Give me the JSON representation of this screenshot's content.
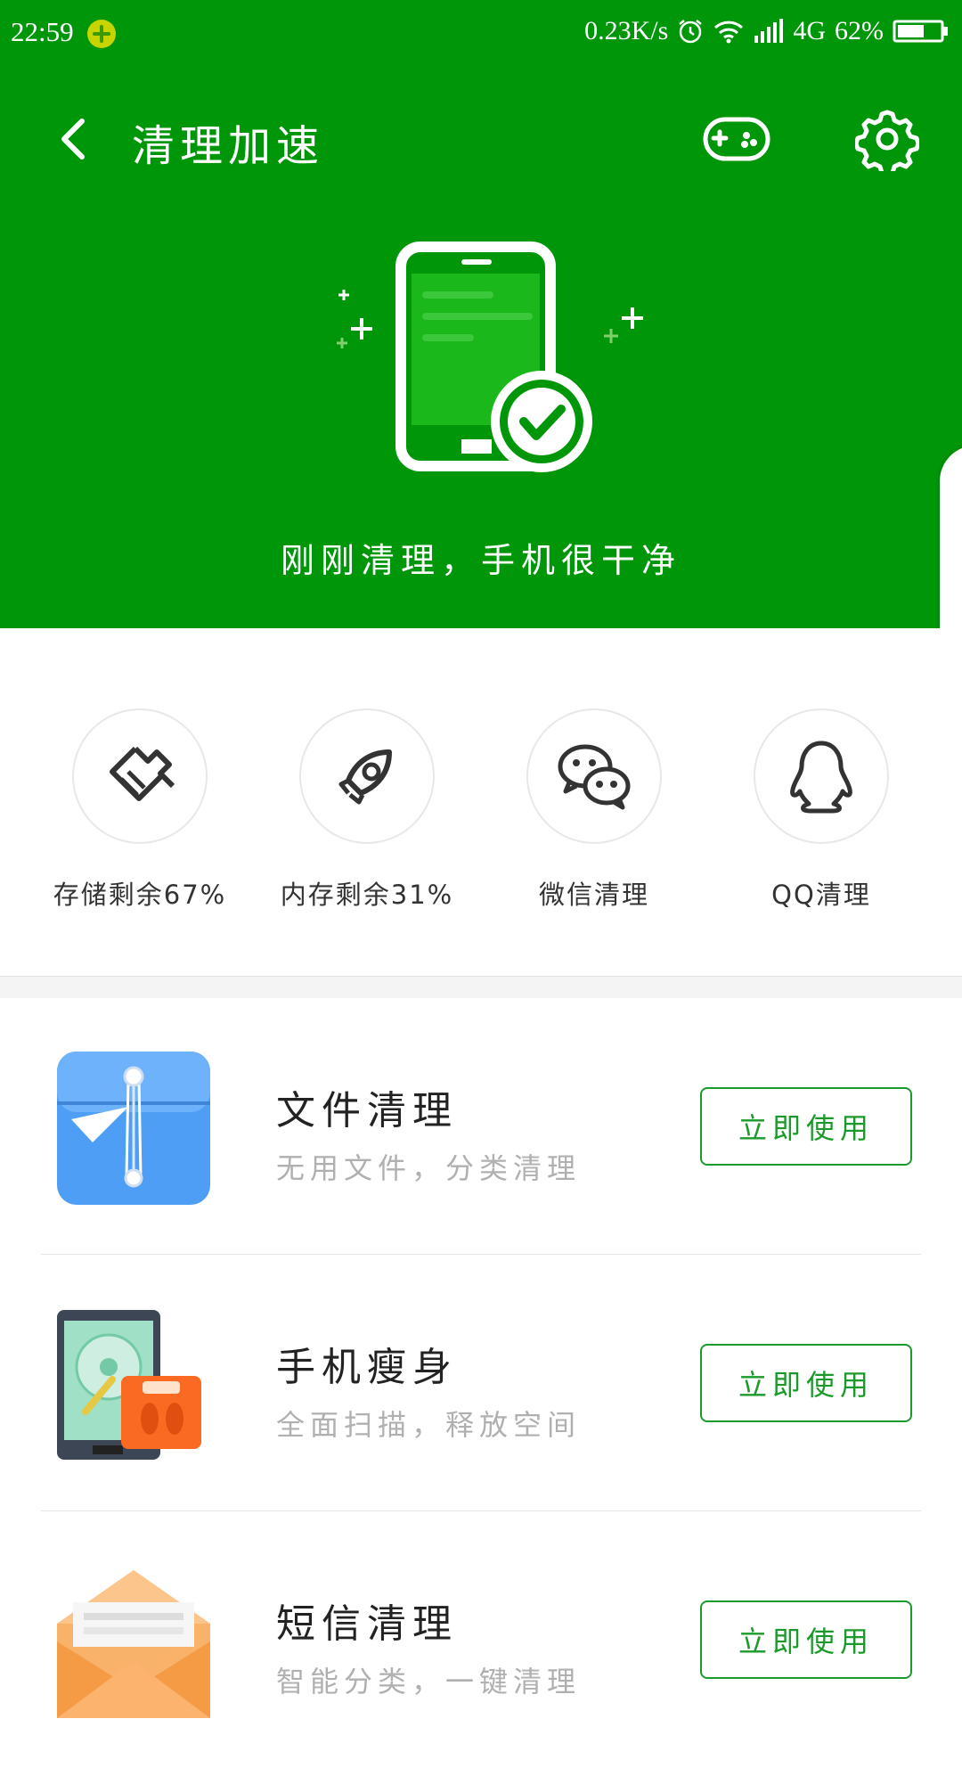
{
  "status_bar": {
    "time": "22:59",
    "speed": "0.23K/s",
    "network": "4G",
    "battery": "62%",
    "battery_level": 0.62
  },
  "header": {
    "title": "清理加速",
    "back_icon": "back-arrow-icon",
    "game_icon": "gamepad-icon",
    "settings_icon": "gear-icon"
  },
  "hero": {
    "status_text": "刚刚清理，手机很干净",
    "illustration": "phone-check-icon"
  },
  "quick_tools": [
    {
      "label": "存储剩余67%",
      "icon": "broom-icon"
    },
    {
      "label": "内存剩余31%",
      "icon": "rocket-icon"
    },
    {
      "label": "微信清理",
      "icon": "wechat-icon"
    },
    {
      "label": "QQ清理",
      "icon": "qq-penguin-icon"
    }
  ],
  "features": [
    {
      "title": "文件清理",
      "subtitle": "无用文件，分类清理",
      "button": "立即使用",
      "icon": "file-folder-icon"
    },
    {
      "title": "手机瘦身",
      "subtitle": "全面扫描，释放空间",
      "button": "立即使用",
      "icon": "phone-slim-icon"
    },
    {
      "title": "短信清理",
      "subtitle": "智能分类，一键清理",
      "button": "立即使用",
      "icon": "envelope-icon"
    }
  ],
  "colors": {
    "brand_green": "#00960a",
    "button_green": "#1a9a2a",
    "subtitle_gray": "#b0b0b0"
  }
}
